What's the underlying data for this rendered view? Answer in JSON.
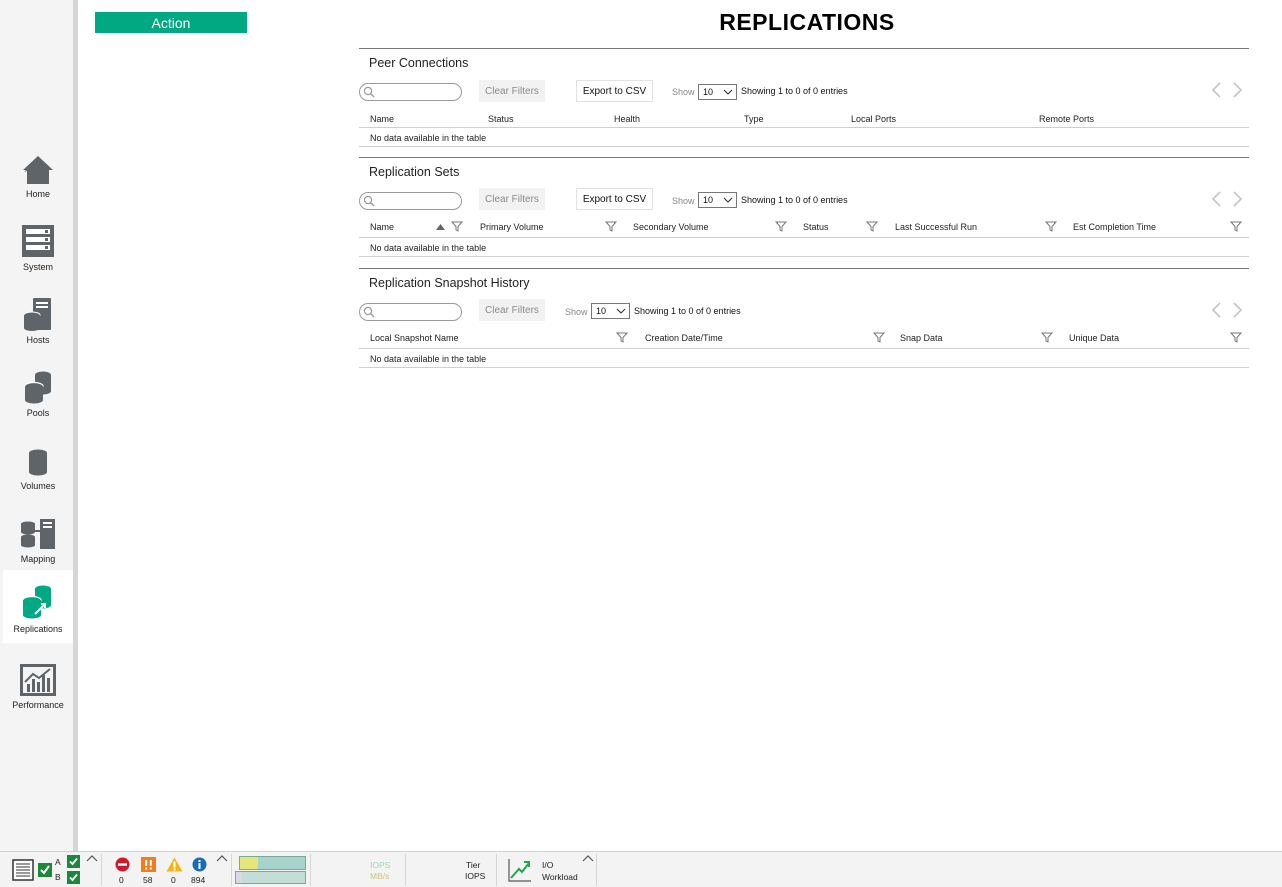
{
  "sidebar": {
    "items": [
      {
        "label": "Home",
        "icon": "home-icon"
      },
      {
        "label": "System",
        "icon": "system-icon"
      },
      {
        "label": "Hosts",
        "icon": "hosts-icon"
      },
      {
        "label": "Pools",
        "icon": "pools-icon"
      },
      {
        "label": "Volumes",
        "icon": "volumes-icon"
      },
      {
        "label": "Mapping",
        "icon": "mapping-icon"
      },
      {
        "label": "Replications",
        "icon": "replications-icon",
        "active": true
      },
      {
        "label": "Performance",
        "icon": "performance-icon"
      }
    ]
  },
  "action_label": "Action",
  "page_title": "REPLICATIONS",
  "colors": {
    "accent": "#01a982",
    "icon_gray": "#5f6468"
  },
  "panels": {
    "peer": {
      "title": "Peer Connections",
      "clear_filters": "Clear Filters",
      "export": "Export to CSV",
      "show_label": "Show",
      "show_value": "10",
      "entries": "Showing 1 to 0 of 0 entries",
      "columns": [
        "Name",
        "Status",
        "Health",
        "Type",
        "Local Ports",
        "Remote Ports"
      ],
      "empty": "No data available in the table"
    },
    "sets": {
      "title": "Replication Sets",
      "clear_filters": "Clear Filters",
      "export": "Export to CSV",
      "show_label": "Show",
      "show_value": "10",
      "entries": "Showing 1 to 0 of 0 entries",
      "columns": [
        "Name",
        "Primary Volume",
        "Secondary Volume",
        "Status",
        "Last Successful Run",
        "Est Completion Time"
      ],
      "empty": "No data available in the table"
    },
    "history": {
      "title": "Replication Snapshot History",
      "clear_filters": "Clear Filters",
      "show_label": "Show",
      "show_value": "10",
      "entries": "Showing 1 to 0 of 0 entries",
      "columns": [
        "Local Snapshot Name",
        "Creation Date/Time",
        "Snap Data",
        "Unique Data"
      ],
      "empty": "No data available in the table"
    }
  },
  "statusbar": {
    "controller_a": "A",
    "controller_b": "B",
    "alerts": {
      "critical": "0",
      "error": "58",
      "warning": "0",
      "info": "894"
    },
    "iops_label": "IOPS",
    "mbs_label": "MB/s",
    "tier_label": "Tier",
    "tier_iops_label": "IOPS",
    "io_label": "I/O",
    "workload_label": "Workload"
  }
}
